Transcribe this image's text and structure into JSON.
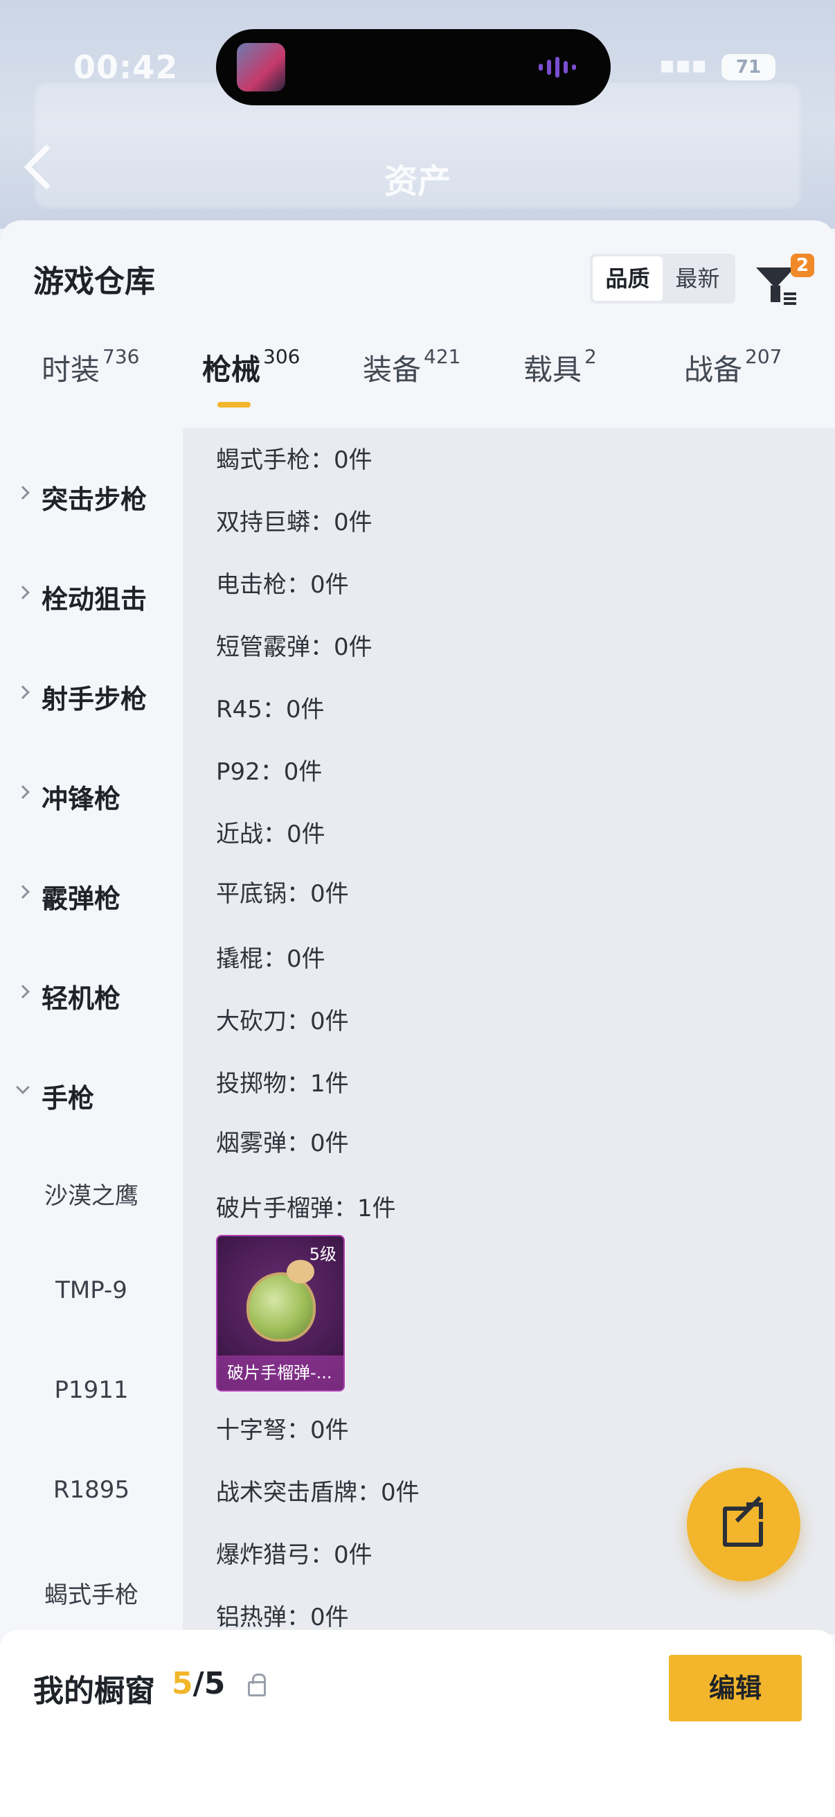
{
  "status": {
    "time": "00:42",
    "battery": "71"
  },
  "header": {
    "title": "资产"
  },
  "warehouse": {
    "title": "游戏仓库",
    "sort_options": [
      "品质",
      "最新"
    ],
    "filter_badge": "2"
  },
  "tabs": [
    {
      "label": "时装",
      "count": "736"
    },
    {
      "label": "枪械",
      "count": "306"
    },
    {
      "label": "装备",
      "count": "421"
    },
    {
      "label": "载具",
      "count": "2"
    },
    {
      "label": "战备",
      "count": "207"
    }
  ],
  "categories": [
    "突击步枪",
    "栓动狙击",
    "射手步枪",
    "冲锋枪",
    "霰弹枪",
    "轻机枪",
    "手枪"
  ],
  "subcategories": [
    "沙漠之鹰",
    "TMP-9",
    "P1911",
    "R1895",
    "蝎式手枪"
  ],
  "items": [
    "蝎式手枪：0件",
    "双持巨蟒：0件",
    "电击枪：0件",
    "短管霰弹：0件",
    "R45：0件",
    "P92：0件",
    "近战：0件",
    "平底锅：0件",
    "撬棍：0件",
    "大砍刀：0件",
    "投掷物：1件",
    "烟雾弹：0件",
    "破片手榴弹：1件",
    "十字弩：0件",
    "战术突击盾牌：0件",
    "爆炸猎弓：0件",
    "铝热弹：0件"
  ],
  "item_card": {
    "level": "5级",
    "name": "破片手榴弹-..."
  },
  "showcase": {
    "title": "我的橱窗",
    "current": "5",
    "total": "/5",
    "edit_label": "编辑"
  },
  "colors": {
    "accent": "#f2b52b",
    "card_border": "#b03fb5"
  }
}
